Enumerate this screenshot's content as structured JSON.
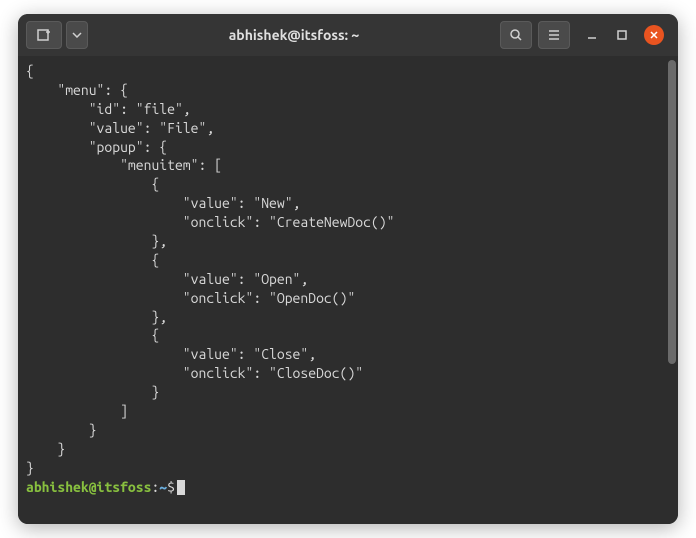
{
  "titlebar": {
    "title": "abhishek@itsfoss: ~"
  },
  "terminal": {
    "output": "{\n    \"menu\": {\n        \"id\": \"file\",\n        \"value\": \"File\",\n        \"popup\": {\n            \"menuitem\": [\n                {\n                    \"value\": \"New\",\n                    \"onclick\": \"CreateNewDoc()\"\n                },\n                {\n                    \"value\": \"Open\",\n                    \"onclick\": \"OpenDoc()\"\n                },\n                {\n                    \"value\": \"Close\",\n                    \"onclick\": \"CloseDoc()\"\n                }\n            ]\n        }\n    }\n}",
    "prompt": {
      "user": "abhishek@itsfoss",
      "colon": ":",
      "path": "~",
      "dollar": "$"
    }
  }
}
